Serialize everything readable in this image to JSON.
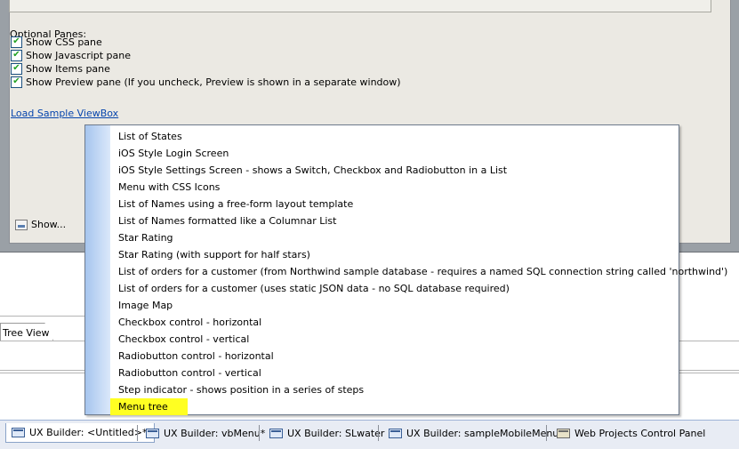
{
  "dialog": {
    "optional_panes_label": "Optional Panes:",
    "checkboxes": [
      {
        "label": "Show CSS pane",
        "checked": true
      },
      {
        "label": "Show Javascript pane",
        "checked": true
      },
      {
        "label": "Show Items pane",
        "checked": true
      },
      {
        "label": "Show Preview pane (If you uncheck, Preview is shown in a separate window)",
        "checked": true
      }
    ],
    "load_sample_link": "Load Sample ViewBox",
    "show_button_label": "Show..."
  },
  "tree_view_tab": "Tree View",
  "popup": {
    "items": [
      "List of States",
      "iOS Style Login Screen",
      "iOS Style Settings Screen - shows a Switch, Checkbox and Radiobutton in a List",
      "Menu with CSS Icons",
      "List of Names using a free-form layout template",
      "List of Names formatted like a Columnar List",
      "Star Rating",
      "Star Rating (with support for half stars)",
      "List of orders for a customer (from Northwind sample database - requires a named SQL connection string called 'northwind')",
      "List of orders for a customer (uses static JSON data - no SQL database required)",
      "Image Map",
      "Checkbox control - horizontal",
      "Checkbox control - vertical",
      "Radiobutton control - horizontal",
      "Radiobutton control - vertical",
      "Step indicator - shows position in a series of steps",
      "Menu tree"
    ],
    "highlighted_item": "Menu tree",
    "highlight_color": "#ffff22"
  },
  "tabs": [
    {
      "label": "UX Builder: <Untitled>*",
      "icon": "window-icon",
      "active": true
    },
    {
      "label": "UX Builder: vbMenu*",
      "icon": "window-icon",
      "active": false
    },
    {
      "label": "UX Builder: SLwater",
      "icon": "window-icon",
      "active": false
    },
    {
      "label": "UX Builder: sampleMobileMenu*",
      "icon": "window-icon",
      "active": false
    },
    {
      "label": "Web Projects Control Panel",
      "icon": "control-panel-icon",
      "active": false
    }
  ]
}
